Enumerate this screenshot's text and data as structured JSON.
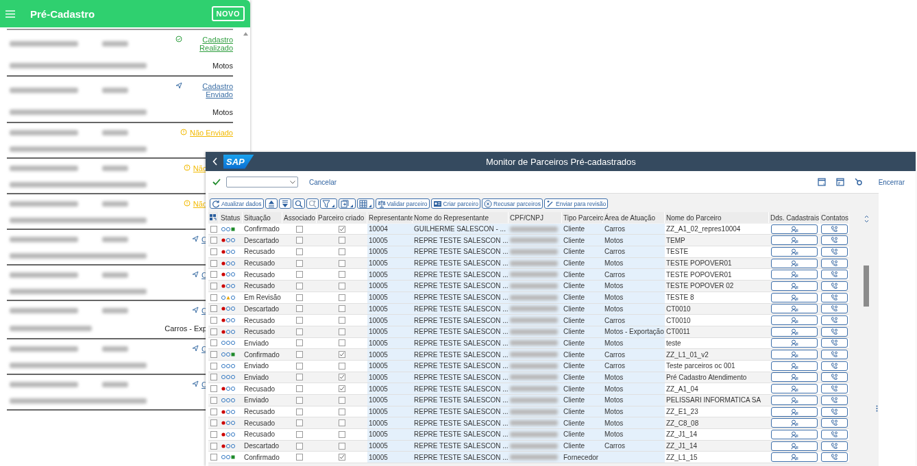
{
  "mobile_app": {
    "title": "Pré-Cadastro",
    "new_button": "NOVO",
    "cards": [
      {
        "status": {
          "kind": "done",
          "label": "Cadastro Realizado"
        },
        "area": "Motos"
      },
      {
        "status": {
          "kind": "sent",
          "label": "Cadastro Enviado"
        },
        "area": "Motos"
      },
      {
        "status": {
          "kind": "pending",
          "label": "Não Enviado"
        }
      },
      {
        "status": {
          "kind": "pending",
          "label": "Não"
        }
      },
      {
        "status": {
          "kind": "pending",
          "label": "Não"
        }
      },
      {
        "status": {
          "kind": "sent",
          "label": "C"
        }
      },
      {
        "status": {
          "kind": "sent",
          "label": "C"
        }
      },
      {
        "status": {
          "kind": "sent",
          "label": "C"
        },
        "area": "Carros - Exp"
      },
      {
        "status": {
          "kind": "sent",
          "label": "C"
        }
      },
      {
        "status": {
          "kind": "sent",
          "label": "C"
        }
      }
    ]
  },
  "sap_window": {
    "logo": "SAP",
    "title": "Monitor de Parceiros Pré-cadastrados",
    "cancel_link": "Cancelar",
    "exit_link": "Encerrar",
    "toolbar": [
      {
        "kind": "refresh",
        "label": "Atualizar dados"
      },
      {
        "kind": "sort-asc"
      },
      {
        "kind": "sort-desc"
      },
      {
        "kind": "search"
      },
      {
        "kind": "search-next"
      },
      {
        "kind": "filter"
      },
      {
        "kind": "export"
      },
      {
        "kind": "layout"
      },
      {
        "kind": "validate",
        "label": "Validar parceiro"
      },
      {
        "kind": "create",
        "label": "Criar parceiro"
      },
      {
        "kind": "reject",
        "label": "Recusar parceiros"
      },
      {
        "kind": "review",
        "label": "Enviar para revisão"
      }
    ],
    "table": {
      "columns": [
        "Status",
        "Situação",
        "Associado",
        "Parceiro criado",
        "Representante",
        "Nome do Representante",
        "CPF/CNPJ",
        "Tipo Parceiro",
        "Área de Atuação",
        "Nome do Parceiro",
        "Dds. Cadastrais",
        "Contatos"
      ],
      "rows": [
        {
          "selected": false,
          "light": {
            "kind": "green"
          },
          "situation": "Confirmado",
          "associated": false,
          "partner_created": true,
          "rep": "10004",
          "rep_name": "GUILHERME SALESCON - ...",
          "type": "Cliente",
          "area": "Carros",
          "partner_name": "ZZ_A1_02_repres10004"
        },
        {
          "selected": false,
          "light": {
            "kind": "red"
          },
          "situation": "Descartado",
          "associated": false,
          "partner_created": false,
          "rep": "10005",
          "rep_name": "REPRE TESTE SALESCON ...",
          "type": "Cliente",
          "area": "Motos",
          "partner_name": "TEMP"
        },
        {
          "selected": false,
          "light": {
            "kind": "red"
          },
          "situation": "Recusado",
          "associated": false,
          "partner_created": false,
          "rep": "10005",
          "rep_name": "REPRE TESTE SALESCON ...",
          "type": "Cliente",
          "area": "Carros",
          "partner_name": "TESTE"
        },
        {
          "selected": false,
          "light": {
            "kind": "red"
          },
          "situation": "Recusado",
          "associated": false,
          "partner_created": false,
          "rep": "10005",
          "rep_name": "REPRE TESTE SALESCON ...",
          "type": "Cliente",
          "area": "Motos",
          "partner_name": "TESTE POPOVER01"
        },
        {
          "selected": false,
          "light": {
            "kind": "red"
          },
          "situation": "Recusado",
          "associated": false,
          "partner_created": false,
          "rep": "10005",
          "rep_name": "REPRE TESTE SALESCON ...",
          "type": "Cliente",
          "area": "Carros",
          "partner_name": "TESTE POPOVER01"
        },
        {
          "selected": false,
          "light": {
            "kind": "red"
          },
          "situation": "Recusado",
          "associated": false,
          "partner_created": false,
          "rep": "10005",
          "rep_name": "REPRE TESTE SALESCON ...",
          "type": "Cliente",
          "area": "Motos",
          "partner_name": "TESTE POPOVER 02"
        },
        {
          "selected": false,
          "light": {
            "kind": "yellow"
          },
          "situation": "Em Revisão",
          "associated": false,
          "partner_created": false,
          "rep": "10005",
          "rep_name": "REPRE TESTE SALESCON ...",
          "type": "Cliente",
          "area": "Motos",
          "partner_name": "TESTE 8"
        },
        {
          "selected": false,
          "light": {
            "kind": "red"
          },
          "situation": "Descartado",
          "associated": false,
          "partner_created": false,
          "rep": "10005",
          "rep_name": "REPRE TESTE SALESCON ...",
          "type": "Cliente",
          "area": "Motos",
          "partner_name": "CT0010"
        },
        {
          "selected": false,
          "light": {
            "kind": "red"
          },
          "situation": "Recusado",
          "associated": false,
          "partner_created": false,
          "rep": "10005",
          "rep_name": "REPRE TESTE SALESCON ...",
          "type": "Cliente",
          "area": "Carros",
          "partner_name": "CT0010"
        },
        {
          "selected": false,
          "light": {
            "kind": "red"
          },
          "situation": "Recusado",
          "associated": false,
          "partner_created": false,
          "rep": "10005",
          "rep_name": "REPRE TESTE SALESCON ...",
          "type": "Cliente",
          "area": "Motos - Exportação",
          "partner_name": "CT0011"
        },
        {
          "selected": false,
          "light": {
            "kind": "none"
          },
          "situation": "Enviado",
          "associated": false,
          "partner_created": false,
          "rep": "10005",
          "rep_name": "REPRE TESTE SALESCON ...",
          "type": "Cliente",
          "area": "Motos",
          "partner_name": "teste"
        },
        {
          "selected": false,
          "light": {
            "kind": "green"
          },
          "situation": "Confirmado",
          "associated": false,
          "partner_created": true,
          "rep": "10005",
          "rep_name": "REPRE TESTE SALESCON ...",
          "type": "Cliente",
          "area": "Carros",
          "partner_name": "ZZ_L1_01_v2"
        },
        {
          "selected": false,
          "light": {
            "kind": "none"
          },
          "situation": "Enviado",
          "associated": false,
          "partner_created": false,
          "rep": "10005",
          "rep_name": "REPRE TESTE SALESCON ...",
          "type": "Cliente",
          "area": "Carros",
          "partner_name": "Teste parceiros oc 001"
        },
        {
          "selected": false,
          "light": {
            "kind": "none"
          },
          "situation": "Enviado",
          "associated": false,
          "partner_created": true,
          "rep": "10005",
          "rep_name": "REPRE TESTE SALESCON ...",
          "type": "Cliente",
          "area": "Motos",
          "partner_name": "Pré Cadastro Atendimento"
        },
        {
          "selected": false,
          "light": {
            "kind": "red"
          },
          "situation": "Recusado",
          "associated": false,
          "partner_created": true,
          "rep": "10005",
          "rep_name": "REPRE TESTE SALESCON ...",
          "type": "Cliente",
          "area": "Motos",
          "partner_name": "ZZ_A1_04"
        },
        {
          "selected": false,
          "light": {
            "kind": "none"
          },
          "situation": "Enviado",
          "associated": false,
          "partner_created": false,
          "rep": "10005",
          "rep_name": "REPRE TESTE SALESCON ...",
          "type": "Cliente",
          "area": "Motos",
          "partner_name": "PELISSARI INFORMATICA SA"
        },
        {
          "selected": false,
          "light": {
            "kind": "red"
          },
          "situation": "Recusado",
          "associated": false,
          "partner_created": false,
          "rep": "10005",
          "rep_name": "REPRE TESTE SALESCON ...",
          "type": "Cliente",
          "area": "Motos",
          "partner_name": "ZZ_E1_23"
        },
        {
          "selected": false,
          "light": {
            "kind": "red"
          },
          "situation": "Recusado",
          "associated": false,
          "partner_created": false,
          "rep": "10005",
          "rep_name": "REPRE TESTE SALESCON ...",
          "type": "Cliente",
          "area": "Motos",
          "partner_name": "ZZ_C8_08"
        },
        {
          "selected": false,
          "light": {
            "kind": "red"
          },
          "situation": "Recusado",
          "associated": false,
          "partner_created": false,
          "rep": "10005",
          "rep_name": "REPRE TESTE SALESCON ...",
          "type": "Cliente",
          "area": "Motos",
          "partner_name": "ZZ_J1_14"
        },
        {
          "selected": false,
          "light": {
            "kind": "red"
          },
          "situation": "Descartado",
          "associated": false,
          "partner_created": false,
          "rep": "10005",
          "rep_name": "REPRE TESTE SALESCON ...",
          "type": "Cliente",
          "area": "Carros",
          "partner_name": "ZZ_J1_14"
        },
        {
          "selected": false,
          "light": {
            "kind": "green"
          },
          "situation": "Confirmado",
          "associated": false,
          "partner_created": true,
          "rep": "10005",
          "rep_name": "REPRE TESTE SALESCON ...",
          "type": "Fornecedor",
          "partner_name": "ZZ_L1_15"
        }
      ]
    }
  }
}
